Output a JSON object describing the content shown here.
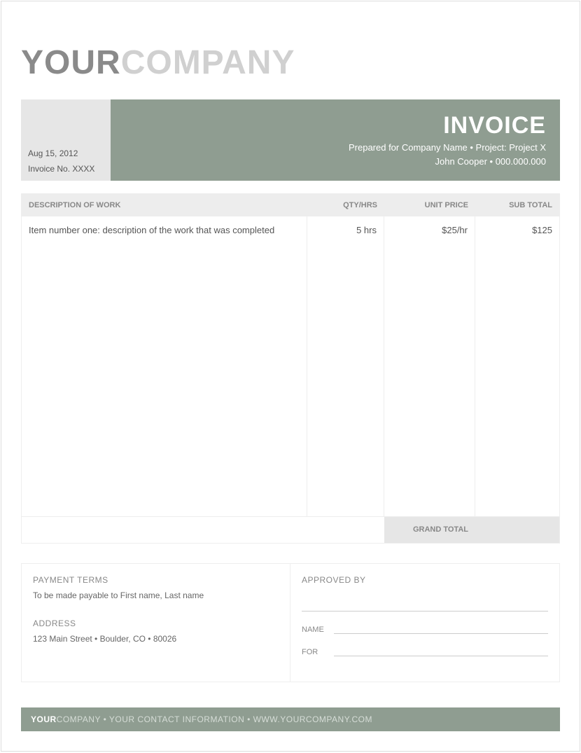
{
  "logo": {
    "part1": "YOUR",
    "part2": "COMPANY"
  },
  "banner": {
    "date": "Aug 15, 2012",
    "invoice_no": "Invoice No. XXXX",
    "title": "INVOICE",
    "line1": "Prepared for Company Name • Project: Project X",
    "line2": "John Cooper • 000.000.000"
  },
  "table": {
    "headers": {
      "desc": "DESCRIPTION OF WORK",
      "qty": "QTY/HRS",
      "unit": "UNIT PRICE",
      "sub": "SUB TOTAL"
    },
    "row": {
      "desc": "Item number one: description of the work that was completed",
      "qty": "5 hrs",
      "unit": "$25/hr",
      "sub": "$125"
    },
    "grand_total_label": "GRAND TOTAL",
    "grand_total_value": ""
  },
  "payment": {
    "terms_h": "PAYMENT TERMS",
    "terms_v": "To be made payable to First name, Last name",
    "addr_h": "ADDRESS",
    "addr_v": "123 Main Street • Boulder, CO • 80026"
  },
  "approval": {
    "heading": "APPROVED BY",
    "name_label": "NAME",
    "for_label": "FOR"
  },
  "footer": {
    "part1": "YOUR",
    "part2": "COMPANY",
    "rest": " • YOUR CONTACT INFORMATION • WWW.YOURCOMPANY.COM"
  }
}
